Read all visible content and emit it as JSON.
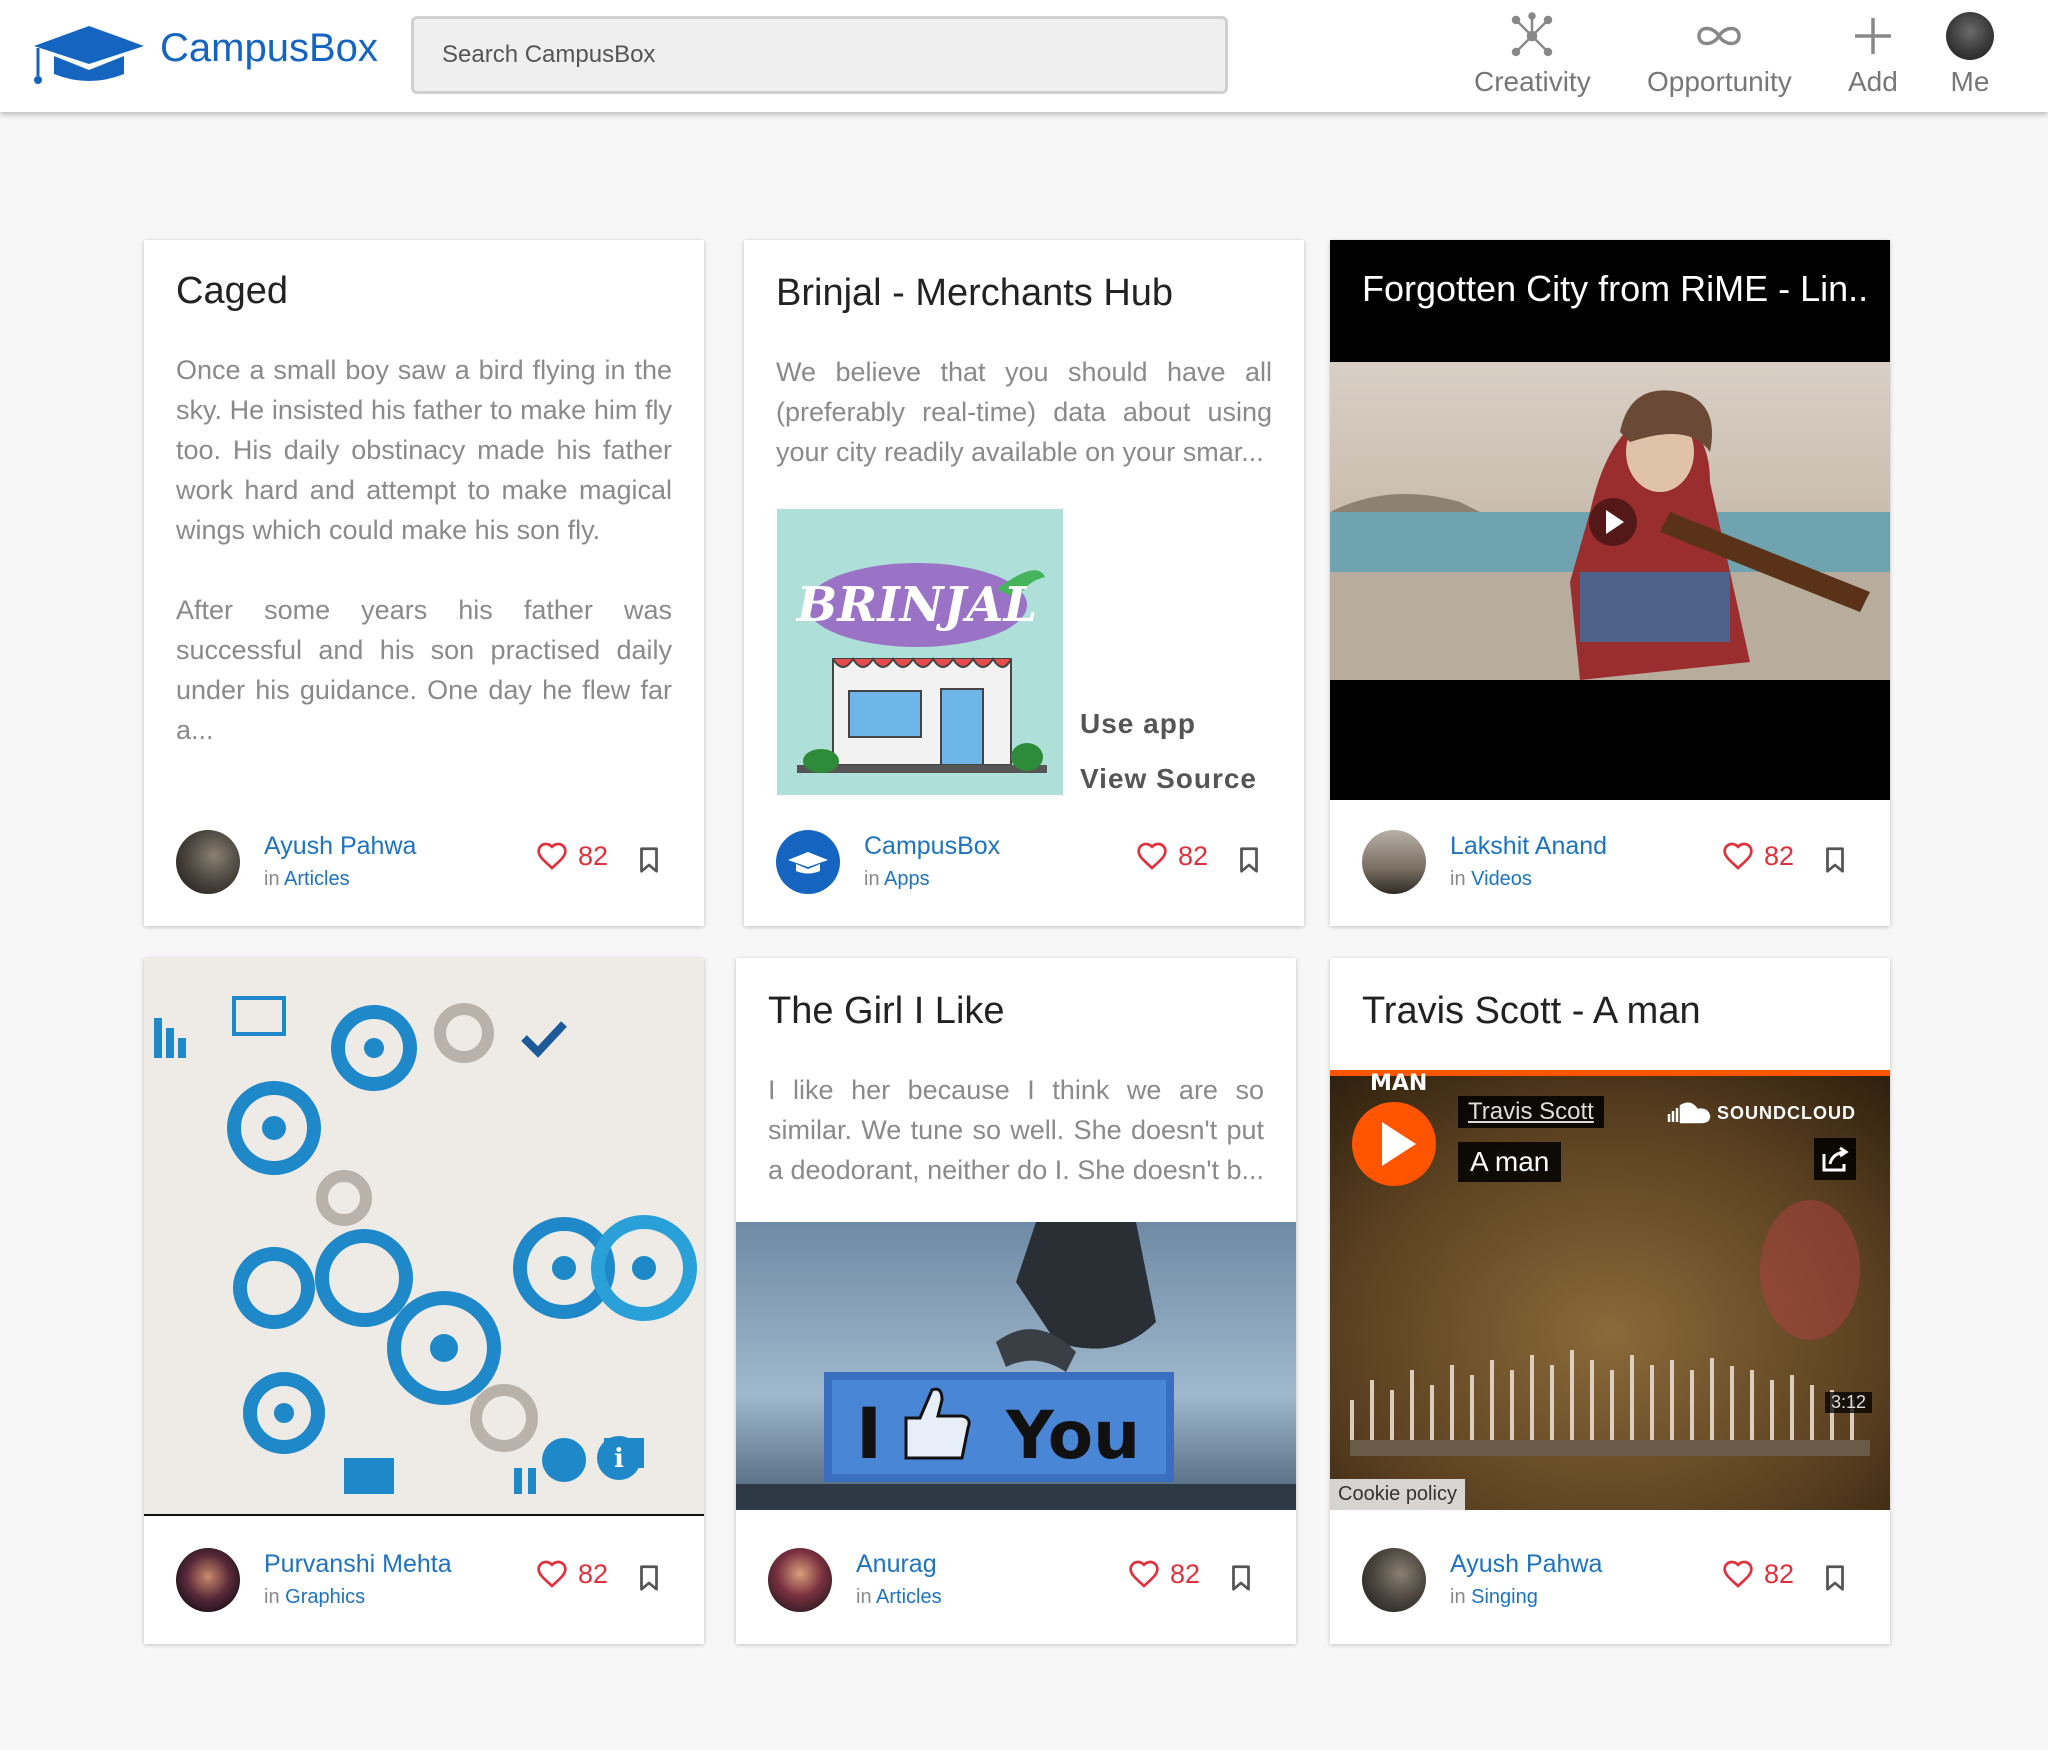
{
  "header": {
    "brand": "CampusBox",
    "search_placeholder": "Search CampusBox",
    "nav": [
      {
        "label": "Creativity",
        "icon": "creativity-network-icon"
      },
      {
        "label": "Opportunity",
        "icon": "infinity-icon"
      },
      {
        "label": "Add",
        "icon": "plus-icon"
      },
      {
        "label": "Me",
        "icon": "avatar"
      }
    ]
  },
  "colors": {
    "brand": "#1565c0",
    "link": "#1e73be",
    "like": "#e0303c",
    "soundcloud_orange": "#ff5500"
  },
  "cards": [
    {
      "title": "Caged",
      "body": [
        "Once a small boy saw a bird flying in the sky. He insisted his father to make him fly too. His daily obstinacy made his father work hard and attempt to make magical wings which could make his son fly.",
        "After some years his father was successful and his son practised daily under his guidance. One day he flew far a..."
      ],
      "author": "Ayush Pahwa",
      "in_label": "in",
      "category": "Articles",
      "likes": "82"
    },
    {
      "title": "Brinjal - Merchants Hub",
      "body": [
        "We believe that you should have all (preferably real-time) data about using your city readily available on your smar..."
      ],
      "image_text": "BRINJAL",
      "use_app": "Use app",
      "view_source": "View Source",
      "author": "CampusBox",
      "in_label": "in",
      "category": "Apps",
      "likes": "82"
    },
    {
      "video_title": "Forgotten City from RiME - Lin..",
      "author": "Lakshit Anand",
      "in_label": "in",
      "category": "Videos",
      "likes": "82"
    },
    {
      "author": "Purvanshi Mehta",
      "in_label": "in",
      "category": "Graphics",
      "likes": "82"
    },
    {
      "title": "The Girl I Like",
      "body": [
        "I like her because I think we are so similar. We tune so well. She doesn't put a deodorant, neither do I. She doesn't b..."
      ],
      "image_text_left": "I",
      "image_text_right": "You",
      "author": "Anurag",
      "in_label": "in",
      "category": "Articles",
      "likes": "82"
    },
    {
      "title": "Travis Scott - A man",
      "player": {
        "artist": "Travis Scott",
        "track": "A man",
        "brand": "SOUNDCLOUD",
        "duration": "3:12",
        "cookie": "Cookie policy",
        "banner": "MAN"
      },
      "author": "Ayush Pahwa",
      "in_label": "in",
      "category": "Singing",
      "likes": "82"
    }
  ]
}
